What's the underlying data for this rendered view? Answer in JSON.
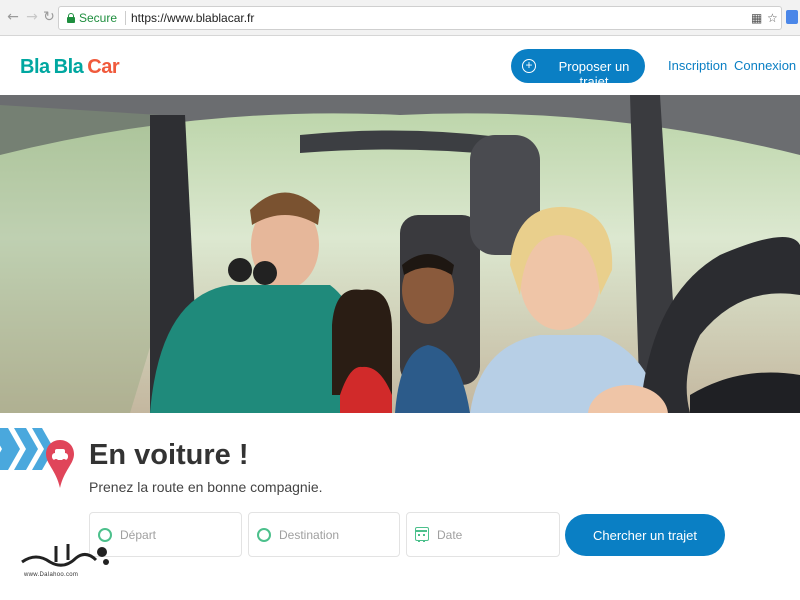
{
  "browser": {
    "secure_label": "Secure",
    "url": "https://www.blablacar.fr",
    "icons": [
      "back-icon",
      "forward-icon",
      "reload-icon",
      "lock-icon",
      "translate-icon",
      "star-icon",
      "extension-icon"
    ]
  },
  "header": {
    "logo": {
      "part1": "Bla",
      "part2": "Bla",
      "part3": "Car"
    },
    "propose_label": "Proposer un trajet",
    "inscription_label": "Inscription",
    "connexion_label": "Connexion"
  },
  "hero": {
    "description": "photo"
  },
  "main": {
    "title": "En voiture !",
    "subtitle": "Prenez la route en bonne compagnie."
  },
  "search": {
    "depart_placeholder": "Départ",
    "destination_placeholder": "Destination",
    "date_placeholder": "Date",
    "button_label": "Chercher un trajet"
  },
  "watermark": {
    "text": "www.Dalahoo.com"
  },
  "colors": {
    "brand_blue": "#0a7fc4",
    "brand_teal": "#00a7a0",
    "brand_orange": "#f05a3c",
    "accent_green": "#4cc08c",
    "pin_red": "#e0455a"
  }
}
